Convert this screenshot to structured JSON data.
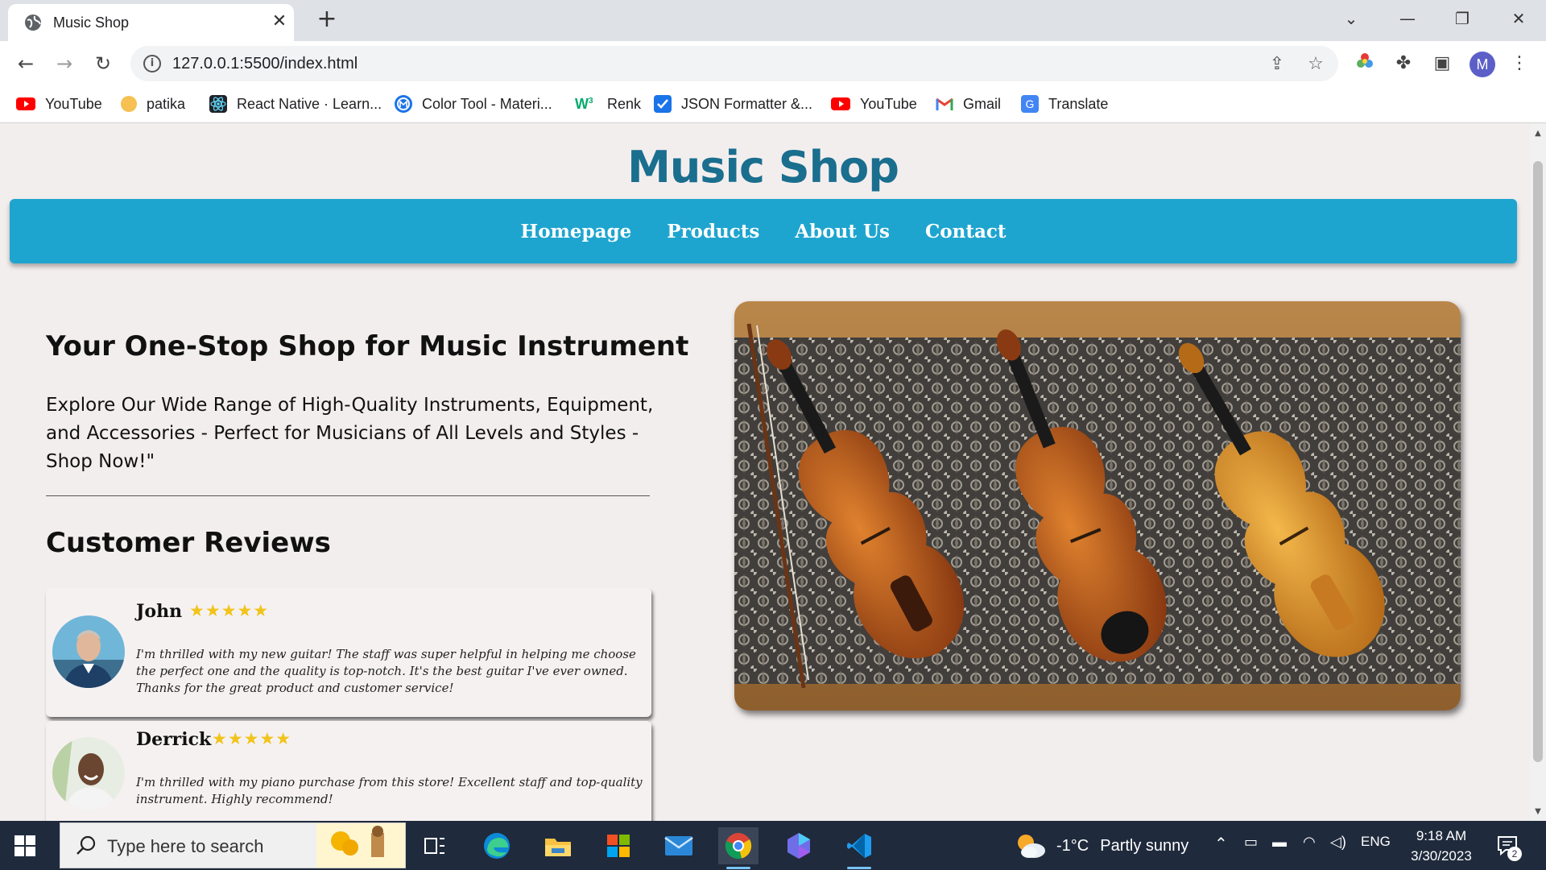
{
  "browser": {
    "tab_title": "Music Shop",
    "url": "127.0.0.1:5500/index.html",
    "profile_initial": "M"
  },
  "bookmarks": [
    {
      "label": "YouTube",
      "icon": "youtube-icon"
    },
    {
      "label": "patika",
      "icon": "patika-icon"
    },
    {
      "label": "React Native · Learn...",
      "icon": "react-icon"
    },
    {
      "label": "Color Tool - Materi...",
      "icon": "material-icon"
    },
    {
      "label": "Renk",
      "icon": "w3-icon"
    },
    {
      "label": "JSON Formatter &...",
      "icon": "json-icon"
    },
    {
      "label": "YouTube",
      "icon": "youtube-icon"
    },
    {
      "label": "Gmail",
      "icon": "gmail-icon"
    },
    {
      "label": "Translate",
      "icon": "translate-icon"
    }
  ],
  "site": {
    "title": "Music Shop",
    "nav": [
      "Homepage",
      "Products",
      "About Us",
      "Contact"
    ],
    "hero_heading": "Your One-Stop Shop for Music Instrument",
    "hero_text": "Explore Our Wide Range of High-Quality Instruments, Equipment, and Accessories - Perfect for Musicians of All Levels and Styles - Shop Now!\"",
    "reviews_heading": "Customer Reviews",
    "reviews": [
      {
        "name": "John",
        "stars": "★★★★★",
        "rating": 5,
        "text": "I'm thrilled with my new guitar! The staff was super helpful in helping me choose the perfect one and the quality is top-notch. It's the best guitar I've ever owned. Thanks for the great product and customer service!"
      },
      {
        "name": "Derrick",
        "stars": "★★★★★",
        "rating": 5,
        "text": "I'm thrilled with my piano purchase from this store! Excellent staff and top-quality instrument. Highly recommend!"
      }
    ]
  },
  "taskbar": {
    "search_placeholder": "Type here to search",
    "weather_temp": "-1°C",
    "weather_desc": "Partly sunny",
    "language": "ENG",
    "time": "9:18 AM",
    "date": "3/30/2023",
    "notification_count": "2"
  },
  "colors": {
    "accent_nav": "#1ea5cf",
    "title": "#1a6e8e",
    "page_bg": "#f3eeee",
    "stars": "#f0c419"
  }
}
